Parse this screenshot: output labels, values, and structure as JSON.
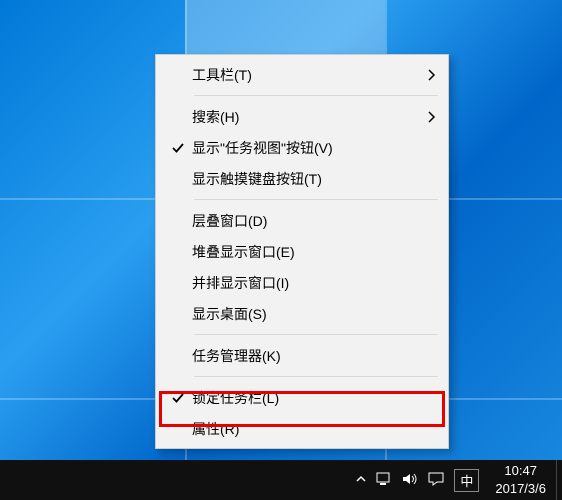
{
  "menu": {
    "items": [
      {
        "label": "工具栏(T)",
        "checked": false,
        "hasSubmenu": true
      },
      {
        "separator": true
      },
      {
        "label": "搜索(H)",
        "checked": false,
        "hasSubmenu": true
      },
      {
        "label": "显示\"任务视图\"按钮(V)",
        "checked": true,
        "hasSubmenu": false
      },
      {
        "label": "显示触摸键盘按钮(T)",
        "checked": false,
        "hasSubmenu": false
      },
      {
        "separator": true
      },
      {
        "label": "层叠窗口(D)",
        "checked": false,
        "hasSubmenu": false
      },
      {
        "label": "堆叠显示窗口(E)",
        "checked": false,
        "hasSubmenu": false
      },
      {
        "label": "并排显示窗口(I)",
        "checked": false,
        "hasSubmenu": false
      },
      {
        "label": "显示桌面(S)",
        "checked": false,
        "hasSubmenu": false
      },
      {
        "separator": true
      },
      {
        "label": "任务管理器(K)",
        "checked": false,
        "hasSubmenu": false
      },
      {
        "separator": true
      },
      {
        "label": "锁定任务栏(L)",
        "checked": true,
        "hasSubmenu": false,
        "highlighted": true
      },
      {
        "label": "属性(R)",
        "checked": false,
        "hasSubmenu": false
      }
    ]
  },
  "taskbar": {
    "ime": "中",
    "time": "10:47",
    "date": "2017/3/6"
  }
}
